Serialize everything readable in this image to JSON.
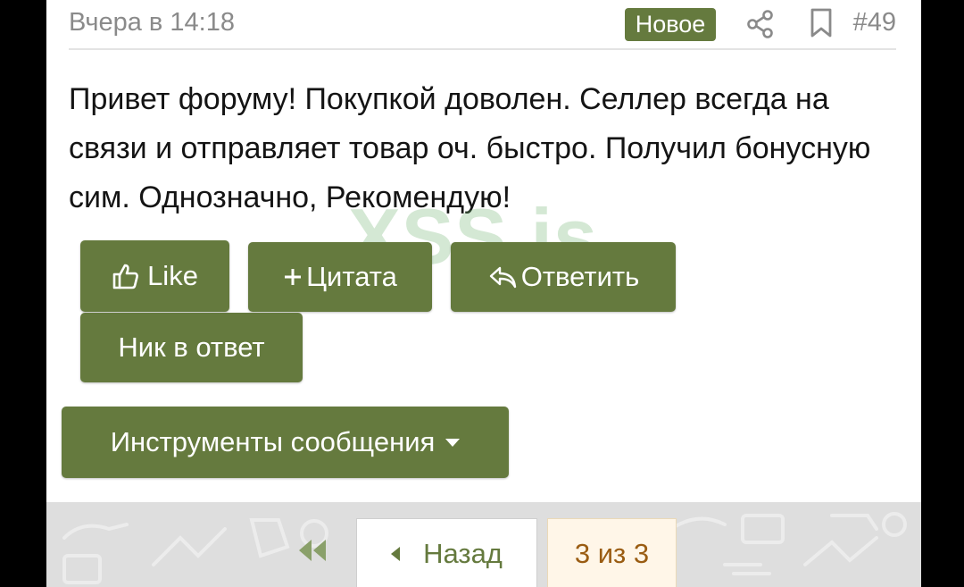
{
  "post": {
    "date": "Вчера в 14:18",
    "badge": "Новое",
    "number": "#49",
    "text": "Привет форуму! Покупкой доволен. Селлер всегда на связи и отправляет товар оч. быстро. Получил бонусную сим. Однозначно, Рекомендую!",
    "watermark": "XSS.is"
  },
  "actions": {
    "like": "Like",
    "quote": "Цитата",
    "reply": "Ответить",
    "nick": "Ник в ответ",
    "tools": "Инструменты сообщения"
  },
  "pagination": {
    "back": "Назад",
    "current": "3 из 3"
  },
  "icons": {
    "share": "share-icon",
    "bookmark": "bookmark-icon",
    "like": "thumbs-up-icon",
    "quote": "plus-icon",
    "reply": "reply-arrow-icon",
    "tools": "caret-down-icon",
    "first": "double-chevron-left-icon",
    "back": "triangle-left-icon"
  },
  "colors": {
    "accent": "#657a3e",
    "muted": "#8a8a8a",
    "current_page_bg": "#fff6e8",
    "current_page_text": "#9a5c12"
  }
}
